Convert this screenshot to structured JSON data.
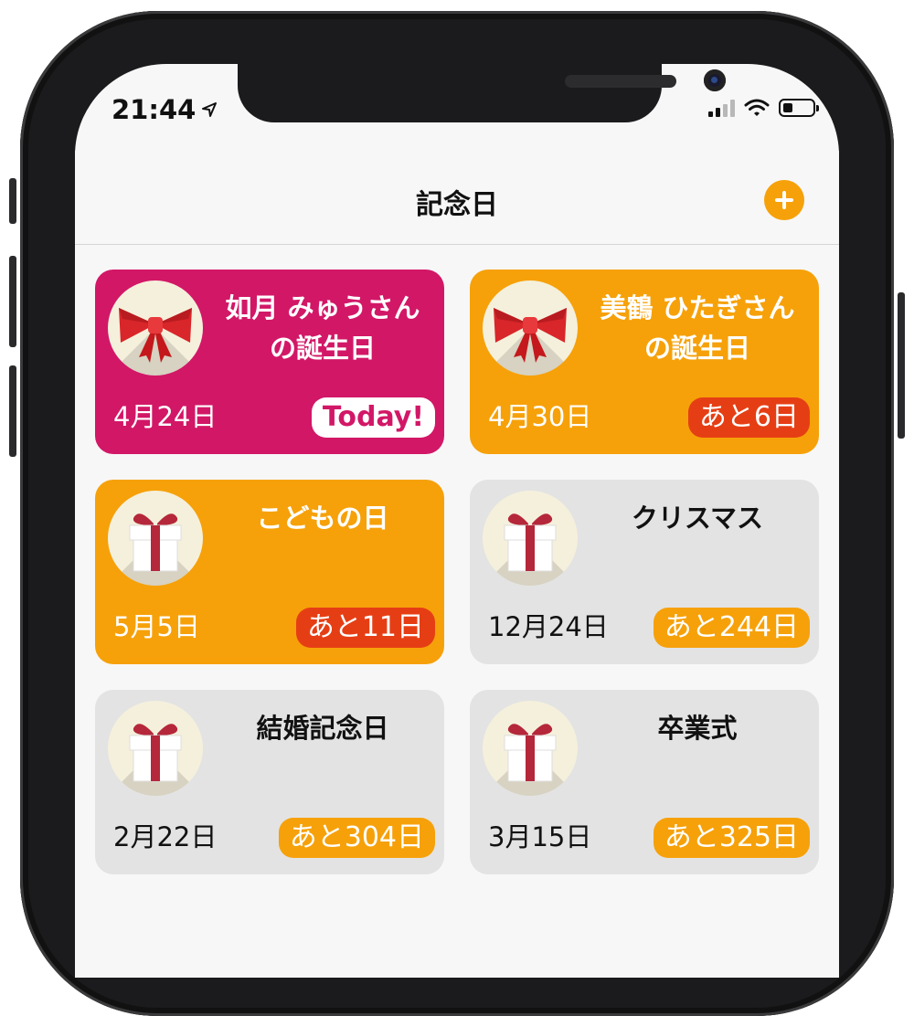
{
  "status_bar": {
    "time": "21:44",
    "location_icon": "location-arrow-icon",
    "signal_icon": "cellular-signal-icon",
    "wifi_icon": "wifi-icon",
    "battery_icon": "battery-icon"
  },
  "nav": {
    "title": "記念日",
    "add_icon": "plus-icon"
  },
  "colors": {
    "pink": "#d21767",
    "orange": "#f6a10a",
    "red": "#e63e14",
    "grey": "#e3e3e3",
    "white": "#ffffff"
  },
  "cards": [
    {
      "title": "如月 みゅうさん\nの誕生日",
      "date": "4月24日",
      "badge": "Today!",
      "icon": "ribbon-bow-icon",
      "theme": "pink",
      "badge_style": "today"
    },
    {
      "title": "美鶴 ひたぎさん\nの誕生日",
      "date": "4月30日",
      "badge": "あと6日",
      "icon": "ribbon-bow-icon",
      "theme": "orange",
      "badge_style": "red"
    },
    {
      "title": "こどもの日",
      "date": "5月5日",
      "badge": "あと11日",
      "icon": "gift-box-icon",
      "theme": "orange",
      "badge_style": "red"
    },
    {
      "title": "クリスマス",
      "date": "12月24日",
      "badge": "あと244日",
      "icon": "gift-box-icon",
      "theme": "grey",
      "badge_style": "amber"
    },
    {
      "title": "結婚記念日",
      "date": "2月22日",
      "badge": "あと304日",
      "icon": "gift-box-icon",
      "theme": "grey",
      "badge_style": "amber"
    },
    {
      "title": "卒業式",
      "date": "3月15日",
      "badge": "あと325日",
      "icon": "gift-box-icon",
      "theme": "grey",
      "badge_style": "amber"
    }
  ]
}
